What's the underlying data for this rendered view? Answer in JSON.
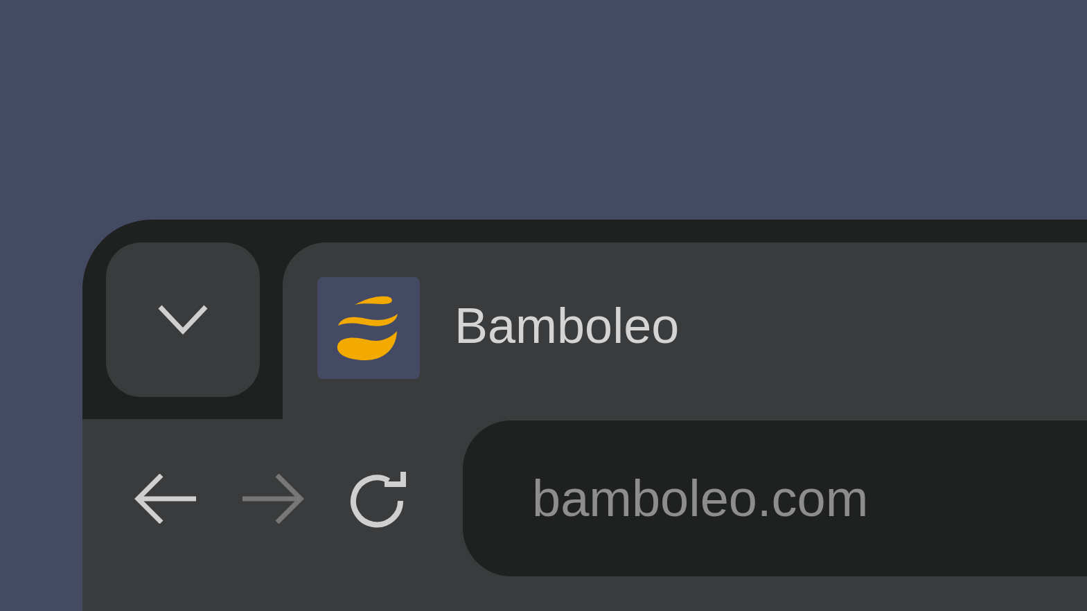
{
  "tab": {
    "title": "Bamboleo",
    "selected": true
  },
  "navigation": [
    {
      "kind": "back",
      "disabled": false
    },
    {
      "kind": "forward",
      "disabled": true
    },
    {
      "kind": "reload",
      "disabled": false
    }
  ],
  "address_bar": {
    "value": "bamboleo.com"
  }
}
